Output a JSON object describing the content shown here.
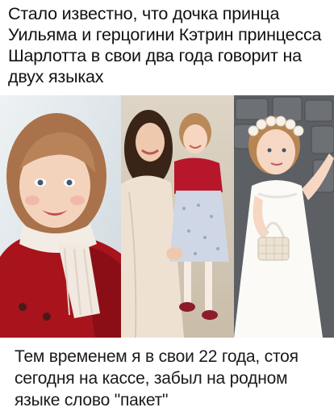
{
  "top_caption": "Стало известно, что дочка принца Уильяма и герцогини Кэтрин принцесса Шарлотта в свои два года говорит на двух языках",
  "bottom_caption": "Тем временем я в свои 22 года, стоя сегодня на кассе,  забыл  на родном языке слово \"пакет\"",
  "photos": [
    {
      "subject": "girl-portrait",
      "colors": {
        "coat": "#a8131c",
        "scarf": "#f3ece4",
        "hair": "#b07a4c",
        "background": "#dfe7ec"
      }
    },
    {
      "subject": "mother-holding-daughter",
      "colors": {
        "coat": "#efe1d2",
        "cardigan": "#b8162a",
        "dress": "#cfd7e6",
        "background": "#d8cbb8"
      }
    },
    {
      "subject": "girl-with-basket",
      "colors": {
        "dress": "#fbfaf6",
        "hair": "#b88552",
        "wall": "#5c5f63",
        "flowers": "#f6f2ea"
      }
    }
  ]
}
